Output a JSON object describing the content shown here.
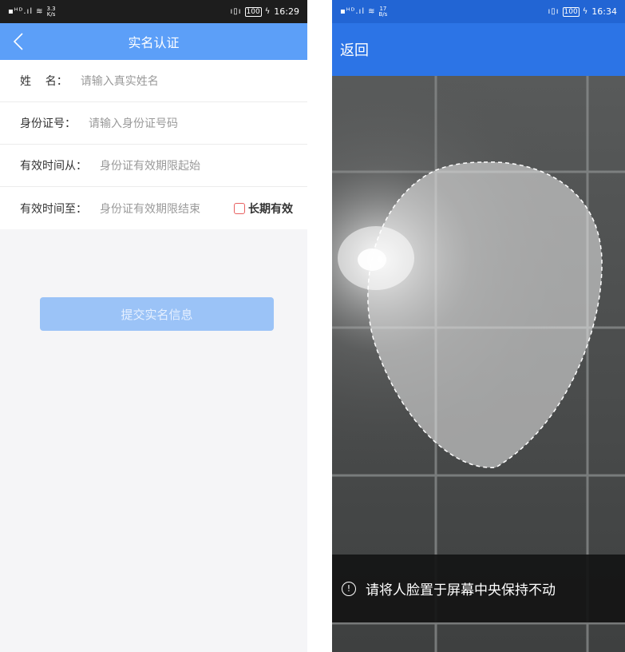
{
  "left_screen": {
    "status": {
      "net_speed_value": "3.3",
      "net_speed_unit": "K/s",
      "battery": "100",
      "time": "16:29"
    },
    "header": {
      "title": "实名认证"
    },
    "form": {
      "rows": [
        {
          "label": "姓    名：",
          "placeholder": "请输入真实姓名"
        },
        {
          "label": "身份证号：",
          "placeholder": "请输入身份证号码"
        },
        {
          "label": "有效时间从：",
          "placeholder": "身份证有效期限起始"
        },
        {
          "label": "有效时间至：",
          "placeholder": "身份证有效期限结束"
        }
      ],
      "long_term_checkbox": {
        "label": "长期有效",
        "checked": false
      }
    },
    "submit_label": "提交实名信息",
    "colors": {
      "header": "#5c9ff8",
      "submit": "#9bc3f7",
      "checkbox_border": "#e86060"
    }
  },
  "right_screen": {
    "status": {
      "net_speed_value": "17",
      "net_speed_unit": "B/s",
      "battery": "100",
      "time": "16:34"
    },
    "header": {
      "back_label": "返回"
    },
    "hint": {
      "text": "请将人脸置于屏幕中央保持不动"
    },
    "colors": {
      "header": "#2c74e6",
      "hint_bar": "#141414"
    }
  }
}
